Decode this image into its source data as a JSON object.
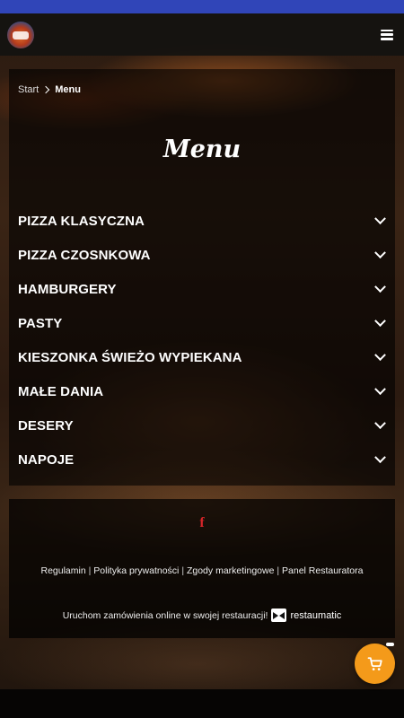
{
  "colors": {
    "status_bar": "#3045b8",
    "accent": "#f49a1a",
    "facebook": "#d8262a"
  },
  "header": {
    "logo_icon": "restaurant-logo",
    "menu_icon": "hamburger-icon"
  },
  "breadcrumb": {
    "start": "Start",
    "current": "Menu"
  },
  "page_title": "Menu",
  "categories": [
    {
      "label": "PIZZA KLASYCZNA"
    },
    {
      "label": "PIZZA CZOSNKOWA"
    },
    {
      "label": "HAMBURGERY"
    },
    {
      "label": "PASTY"
    },
    {
      "label": "KIESZONKA ŚWIEŻO WYPIEKANA"
    },
    {
      "label": "MAŁE DANIA"
    },
    {
      "label": "DESERY"
    },
    {
      "label": "NAPOJE"
    }
  ],
  "footer": {
    "social_icon": "facebook-icon",
    "links": [
      "Regulamin",
      "Polityka prywatności",
      "Zgody marketingowe",
      "Panel Restauratora"
    ],
    "separator": "|",
    "promo_text": "Uruchom zamówienia online w swojej restauracji!",
    "brand": "restaumatic"
  },
  "cart_button": {
    "icon": "cart-icon"
  }
}
